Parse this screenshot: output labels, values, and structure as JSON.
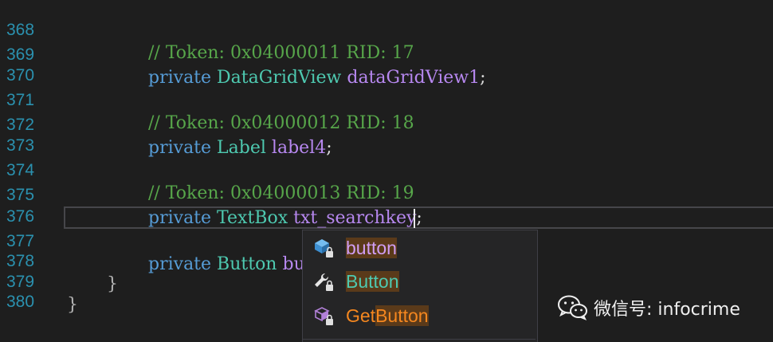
{
  "editor": {
    "lines": [
      {
        "num": "368",
        "indent": 0,
        "comment": "// Token: 0x04000011 RID: 17"
      },
      {
        "num": "369",
        "kw": "private",
        "type": "DataGridView",
        "ident": "dataGridView1",
        "end": ";"
      },
      {
        "num": "370"
      },
      {
        "num": "371",
        "comment": "// Token: 0x04000012 RID: 18"
      },
      {
        "num": "372",
        "kw": "private",
        "type": "Label",
        "ident": "label4",
        "end": ";"
      },
      {
        "num": "373"
      },
      {
        "num": "374",
        "comment": "// Token: 0x04000013 RID: 19"
      },
      {
        "num": "375",
        "kw": "private",
        "type": "TextBox",
        "ident": "txt_searchkey",
        "end": ";"
      },
      {
        "num": "376"
      },
      {
        "num": "377",
        "kw": "private",
        "type": "Button",
        "ident": "buttonRest",
        "end": ";"
      },
      {
        "num": "378",
        "brace": "}"
      },
      {
        "num": "379",
        "brace": "}"
      },
      {
        "num": "380"
      }
    ]
  },
  "completion": {
    "items": [
      {
        "icon": "keyword-icon",
        "prefix": "",
        "match": "button",
        "suffix": "",
        "color": "#d19ef5"
      },
      {
        "icon": "wrench-icon",
        "prefix": "",
        "match": "Button",
        "suffix": "",
        "color": "#4ec9b0"
      },
      {
        "icon": "method-cube-icon",
        "prefix": "Get",
        "match": "Button",
        "suffix": "",
        "color": "#f5871f"
      }
    ]
  },
  "watermark": {
    "text": "微信号: infocrime"
  }
}
